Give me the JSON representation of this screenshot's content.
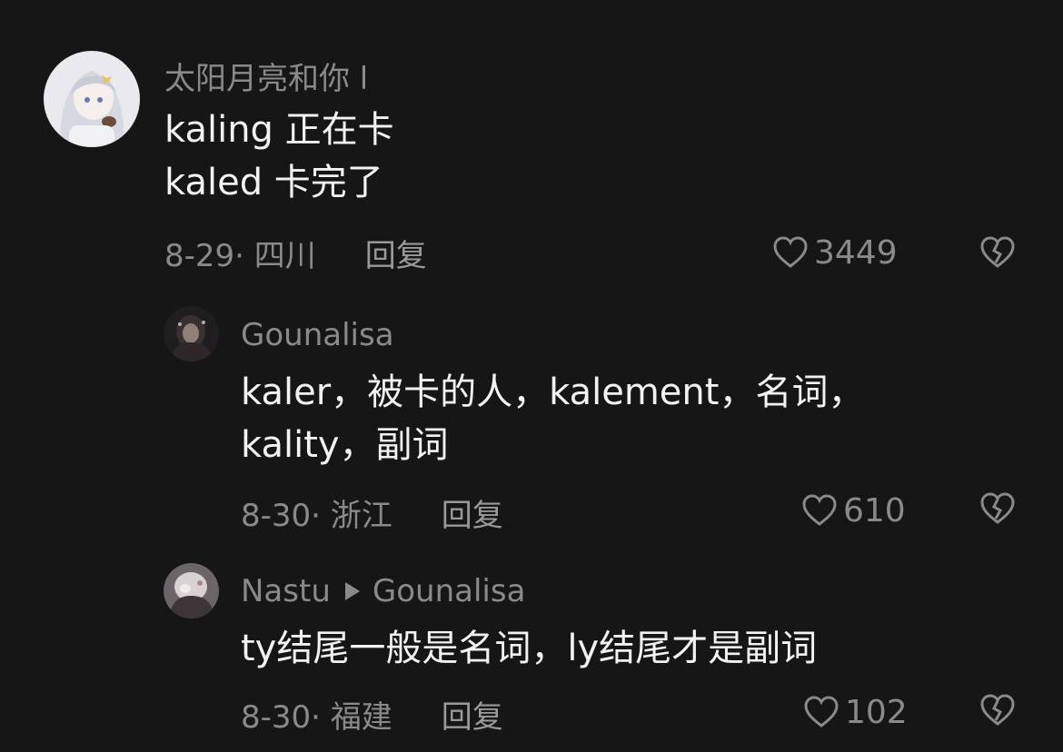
{
  "comments": [
    {
      "username": "太阳月亮和你 l",
      "lines": [
        "kaling 正在卡",
        "kaled 卡完了"
      ],
      "date_location": "8-29· 四川",
      "reply_label": "回复",
      "likes": "3449"
    },
    {
      "username": "Gounalisa",
      "lines": [
        "kaler，被卡的人，kalement，名词，",
        "kality，副词"
      ],
      "date_location": "8-30· 浙江",
      "reply_label": "回复",
      "likes": "610"
    },
    {
      "username": "Nastu",
      "reply_to": "Gounalisa",
      "lines": [
        "ty结尾一般是名词，ly结尾才是副词"
      ],
      "date_location": "8-30· 福建",
      "reply_label": "回复",
      "likes": "102"
    }
  ],
  "icons": {
    "like": "heart-outline-icon",
    "dislike": "broken-heart-icon"
  },
  "colors": {
    "background": "#161616",
    "text": "#f2f2f2",
    "muted": "#8a8a8a"
  }
}
